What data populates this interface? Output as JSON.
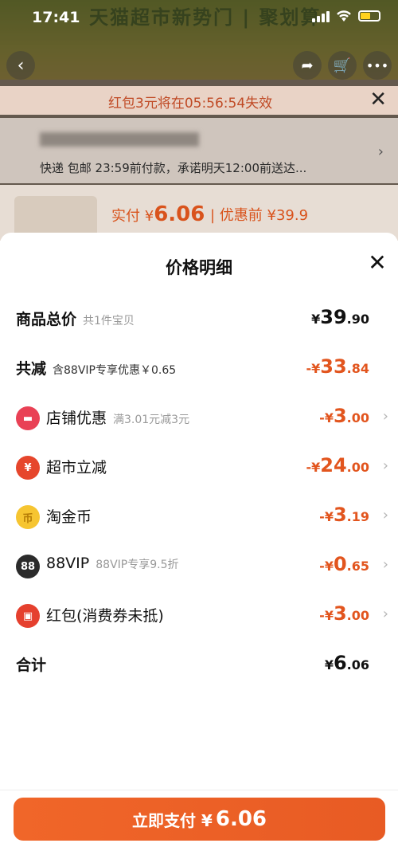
{
  "status_bar": {
    "time": "17:41"
  },
  "background": {
    "banner_text": "天猫超市新势门 | 聚划算",
    "redpacket_tip": "红包3元将在05:56:54失效",
    "shipping": "快递 包邮 23:59前付款，承诺明天12:00前送达...",
    "paid_label": "实付 ¥",
    "paid_amount": "6.06",
    "before_label": "| 优惠前 ¥39.9"
  },
  "sheet": {
    "title": "价格明细",
    "rows": [
      {
        "label": "商品总价",
        "sub": "共1件宝贝",
        "amount_int": "39",
        "amount_dec": ".90",
        "prefix": "¥"
      },
      {
        "label": "共减",
        "sub": "含88VIP专享优惠￥0.65",
        "amount_int": "33",
        "amount_dec": ".84",
        "prefix": "-¥"
      },
      {
        "label": "店铺优惠",
        "sub": "满3.01元减3元",
        "amount_int": "3",
        "amount_dec": ".00",
        "prefix": "-¥",
        "icon": "shop-icon"
      },
      {
        "label": "超市立减",
        "sub": "",
        "amount_int": "24",
        "amount_dec": ".00",
        "prefix": "-¥",
        "icon": "market-discount-icon"
      },
      {
        "label": "淘金币",
        "sub": "",
        "amount_int": "3",
        "amount_dec": ".19",
        "prefix": "-¥",
        "icon": "taojinbi-coin-icon"
      },
      {
        "label": "88VIP",
        "sub": "88VIP专享9.5折",
        "amount_int": "0",
        "amount_dec": ".65",
        "prefix": "-¥",
        "icon": "vip88-icon",
        "icon_text": "88"
      },
      {
        "label": "红包(消费券未抵)",
        "sub": "",
        "amount_int": "3",
        "amount_dec": ".00",
        "prefix": "-¥",
        "icon": "red-packet-icon"
      },
      {
        "label": "合计",
        "sub": "",
        "amount_int": "6",
        "amount_dec": ".06",
        "prefix": "¥"
      }
    ]
  },
  "pay_button": {
    "label": "立即支付 ¥",
    "amount": "6.06"
  },
  "colors": {
    "accent": "#e2551e",
    "pay_button": "#ef6428"
  }
}
